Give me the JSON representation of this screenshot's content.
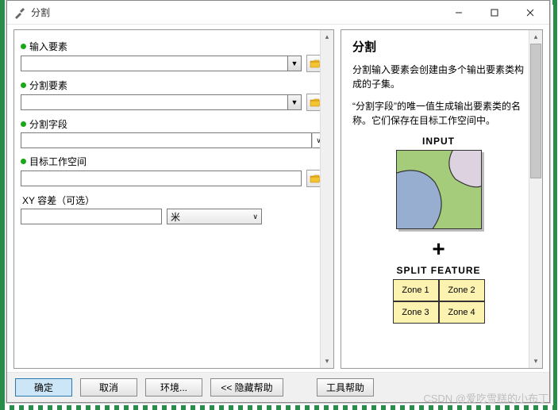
{
  "window": {
    "title": "分割"
  },
  "fields": {
    "input_elem": {
      "label": "输入要素"
    },
    "split_elem": {
      "label": "分割要素"
    },
    "split_field": {
      "label": "分割字段"
    },
    "target_ws": {
      "label": "目标工作空间"
    },
    "xy_tol": {
      "label": "XY 容差（可选）",
      "unit": "米"
    }
  },
  "help": {
    "title": "分割",
    "p1": "分割输入要素会创建由多个输出要素类构成的子集。",
    "p2": "“分割字段”的唯一值生成输出要素类的名称。它们保存在目标工作空间中。",
    "input_label": "INPUT",
    "split_label": "SPLIT FEATURE",
    "plus": "+",
    "zones": {
      "z1": "Zone 1",
      "z2": "Zone 2",
      "z3": "Zone 3",
      "z4": "Zone 4"
    }
  },
  "buttons": {
    "ok": "确定",
    "cancel": "取消",
    "env": "环境...",
    "hide_help": "<< 隐藏帮助",
    "tool_help": "工具帮助"
  },
  "watermark": "CSDN @爱吃雪糕的小布丁"
}
